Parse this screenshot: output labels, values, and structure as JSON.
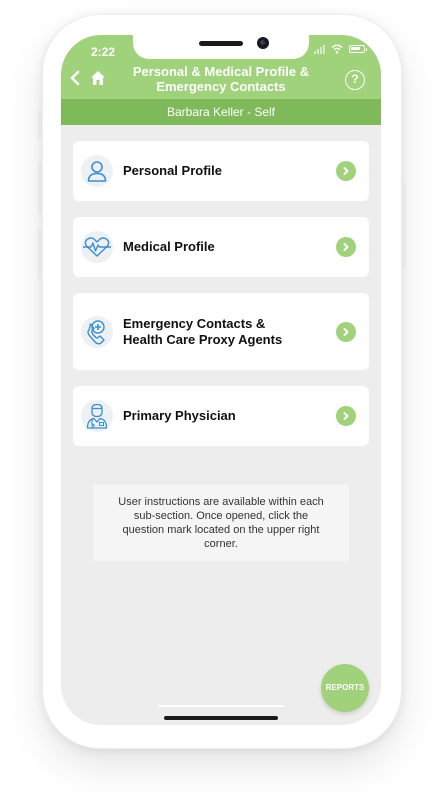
{
  "status_bar": {
    "time": "2:22"
  },
  "header": {
    "title_line1": "Personal & Medical Profile &",
    "title_line2": "Emergency Contacts",
    "back_icon": "chevron-left-icon",
    "home_icon": "home-icon",
    "help_label": "?"
  },
  "subheader": {
    "user": "Barbara Keller - Self"
  },
  "menu": {
    "items": [
      {
        "icon": "person-icon",
        "label": "Personal Profile"
      },
      {
        "icon": "heart-pulse-icon",
        "label": "Medical Profile"
      },
      {
        "icon": "phone-medical-icon",
        "label_line1": "Emergency Contacts &",
        "label_line2": "Health Care Proxy Agents"
      },
      {
        "icon": "doctor-icon",
        "label": "Primary Physician"
      }
    ]
  },
  "info": {
    "text": "User instructions are available within each sub-section. Once opened, click the question mark located on the upper right corner."
  },
  "reports_button": {
    "label": "REPORTS"
  },
  "colors": {
    "accent": "#9fd27a",
    "accent_dark": "#7fba5a",
    "background": "#ededed",
    "icon": "#3a8fd0"
  }
}
